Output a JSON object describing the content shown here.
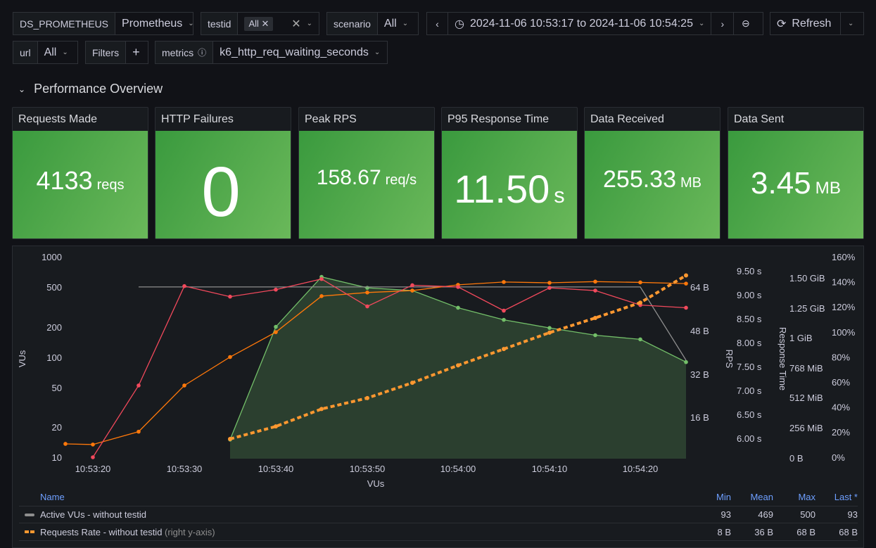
{
  "controls": {
    "datasource": {
      "label": "DS_PROMETHEUS",
      "value": "Prometheus"
    },
    "testid": {
      "label": "testid",
      "value": "All"
    },
    "scenario": {
      "label": "scenario",
      "value": "All"
    },
    "time_range": "2024-11-06 10:53:17 to 2024-11-06 10:54:25",
    "refresh": "Refresh",
    "url": {
      "label": "url",
      "value": "All"
    },
    "filters": "Filters",
    "metrics": {
      "label": "metrics",
      "value": "k6_http_req_waiting_seconds"
    }
  },
  "row_title": "Performance Overview",
  "stats": [
    {
      "title": "Requests Made",
      "value": "4133",
      "unit": "reqs"
    },
    {
      "title": "HTTP Failures",
      "value": "0",
      "unit": ""
    },
    {
      "title": "Peak RPS",
      "value": "158.67",
      "unit": "req/s"
    },
    {
      "title": "P95 Response Time",
      "value": "11.50",
      "unit": "s"
    },
    {
      "title": "Data Received",
      "value": "255.33",
      "unit": "MB"
    },
    {
      "title": "Data Sent",
      "value": "3.45",
      "unit": "MB"
    }
  ],
  "colors": {
    "green": "#73bf69",
    "orange": "#ff9830",
    "red": "#f2495c",
    "grey": "#8e8e8e",
    "stat_bg": "#56a64b"
  },
  "chart_data": {
    "type": "line",
    "x": [
      "10:53:17",
      "10:53:20",
      "10:53:25",
      "10:53:30",
      "10:53:35",
      "10:53:40",
      "10:53:45",
      "10:53:50",
      "10:53:55",
      "10:54:00",
      "10:54:05",
      "10:54:10",
      "10:54:15",
      "10:54:20",
      "10:54:25"
    ],
    "x_ticks": [
      "10:53:20",
      "10:53:30",
      "10:53:40",
      "10:53:50",
      "10:54:00",
      "10:54:10",
      "10:54:20"
    ],
    "xlabel": "VUs",
    "y_left": {
      "label": "VUs",
      "scale": "log",
      "ticks": [
        "1000",
        "500",
        "200",
        "100",
        "50",
        "20",
        "10"
      ]
    },
    "y_bytes": {
      "ticks": [
        "64 B",
        "48 B",
        "32 B",
        "16 B"
      ]
    },
    "y_rps": {
      "label": "RPS",
      "ticks": [
        "9.50 s",
        "9.00 s",
        "8.50 s",
        "8.00 s",
        "7.50 s",
        "7.00 s",
        "6.50 s",
        "6.00 s"
      ]
    },
    "y_mem": {
      "label": "Response Time",
      "ticks": [
        "1.50 GiB",
        "1.25 GiB",
        "1 GiB",
        "768 MiB",
        "512 MiB",
        "256 MiB",
        "0 B"
      ]
    },
    "y_pct": {
      "ticks": [
        "160%",
        "140%",
        "120%",
        "100%",
        "80%",
        "60%",
        "40%",
        "20%",
        "0%"
      ]
    },
    "series": [
      {
        "name": "Active VUs - without testid",
        "color": "#8e8e8e",
        "axis": "left",
        "values": [
          null,
          null,
          500,
          500,
          500,
          500,
          500,
          500,
          500,
          500,
          500,
          500,
          500,
          500,
          93
        ]
      },
      {
        "color": "#f2495c",
        "axis": "left",
        "values": [
          null,
          10,
          52,
          510,
          400,
          470,
          600,
          320,
          520,
          500,
          290,
          490,
          460,
          330,
          310
        ]
      },
      {
        "color": "#ff780a",
        "axis": "left",
        "values": [
          13.6,
          13.4,
          18,
          52,
          100,
          177,
          405,
          440,
          460,
          525,
          560,
          550,
          565,
          555,
          540
        ]
      },
      {
        "color": "#73bf69",
        "axis": "left",
        "fill": true,
        "values": [
          null,
          null,
          null,
          null,
          15,
          200,
          630,
          490,
          460,
          310,
          235,
          195,
          165,
          150,
          89
        ]
      },
      {
        "name": "Requests Rate - without testid",
        "color": "#ff9830",
        "axis": "bytes",
        "dashed": true,
        "values": [
          null,
          null,
          null,
          null,
          8,
          12.6,
          19,
          23,
          28.6,
          35,
          41,
          47,
          52.4,
          58,
          68
        ]
      }
    ]
  },
  "legend": {
    "headers": [
      "Name",
      "Min",
      "Mean",
      "Max",
      "Last *"
    ],
    "rows": [
      {
        "name": "Active VUs - without testid",
        "suffix": "",
        "min": "93",
        "mean": "469",
        "max": "500",
        "last": "93"
      },
      {
        "name": "Requests Rate - without testid",
        "suffix": "(right y-axis)",
        "min": "8 B",
        "mean": "36 B",
        "max": "68 B",
        "last": "68 B"
      }
    ]
  }
}
